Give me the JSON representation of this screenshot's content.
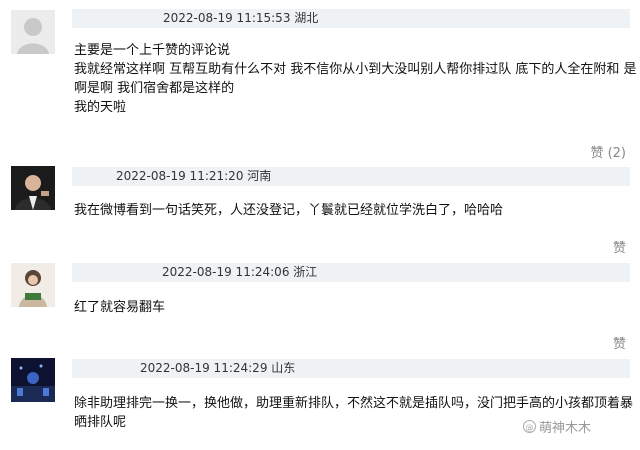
{
  "comments": [
    {
      "username": "",
      "time": "2022-08-19 11:15:53",
      "location": "湖北",
      "lines": [
        "主要是一个上千赞的评论说",
        "我就经常这样啊 互帮互助有什么不对 我不信你从小到大没叫别人帮你排过队 底下的人全在附和 是",
        "啊是啊 我们宿舍都是这样的",
        "我的天啦"
      ],
      "like": "赞 (2)"
    },
    {
      "username": "",
      "time": "2022-08-19 11:21:20",
      "location": "河南",
      "lines": [
        "我在微博看到一句话笑死，人还没登记，丫鬟就已经就位学洗白了，哈哈哈"
      ],
      "like": "赞"
    },
    {
      "username": "",
      "time": "2022-08-19 11:24:06",
      "location": "浙江",
      "lines": [
        "红了就容易翻车"
      ],
      "like": "赞"
    },
    {
      "username": "",
      "time": "2022-08-19 11:24:29",
      "location": "山东",
      "lines": [
        "除非助理排完一换一，换他做，助理重新排队，不然这不就是插队吗，没门把手高的小孩都顶着暴",
        "晒排队呢"
      ]
    }
  ],
  "watermark": {
    "text": "萌神木木",
    "icon": "at-icon"
  }
}
